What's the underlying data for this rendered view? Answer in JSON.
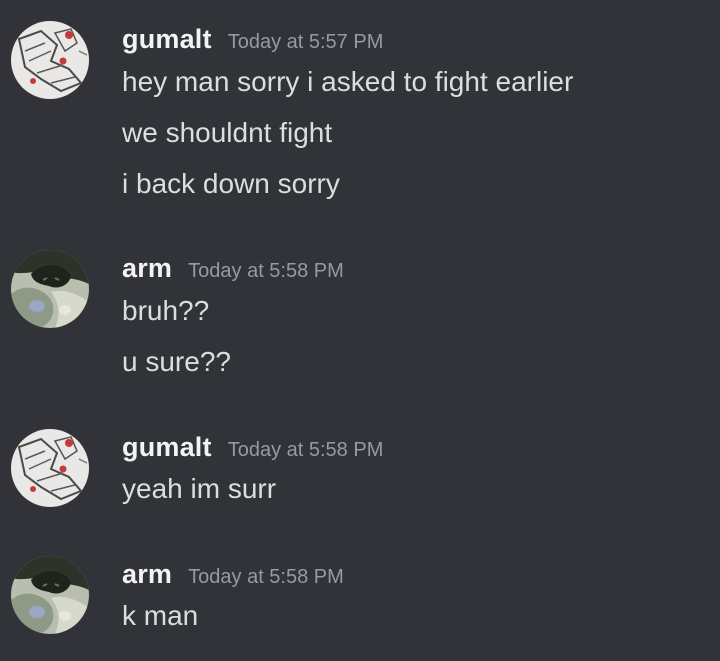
{
  "colors": {
    "background": "#313338",
    "username": "#f2f3f5",
    "timestamp": "#949ba4",
    "message_text": "#dbdee1"
  },
  "messages": [
    {
      "avatar_icon": "sneaker-sketch-avatar",
      "username": "gumalt",
      "timestamp": "Today at 5:57 PM",
      "lines": [
        "hey man sorry i asked to fight earlier",
        "we shouldnt fight",
        "i back down sorry"
      ]
    },
    {
      "avatar_icon": "dark-creature-avatar",
      "username": "arm",
      "timestamp": "Today at 5:58 PM",
      "lines": [
        "bruh??",
        "u sure??"
      ]
    },
    {
      "avatar_icon": "sneaker-sketch-avatar",
      "username": "gumalt",
      "timestamp": "Today at 5:58 PM",
      "lines": [
        "yeah im surr"
      ]
    },
    {
      "avatar_icon": "dark-creature-avatar",
      "username": "arm",
      "timestamp": "Today at 5:58 PM",
      "lines": [
        "k man"
      ]
    }
  ]
}
